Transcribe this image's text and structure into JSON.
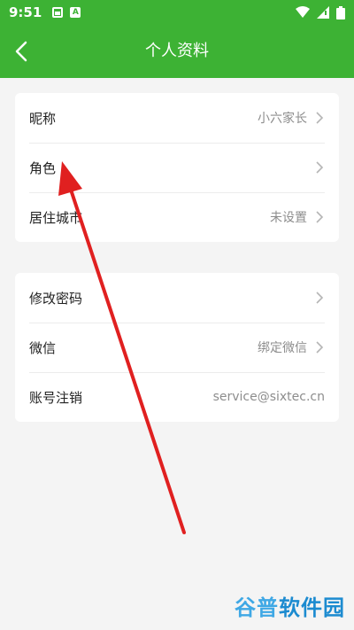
{
  "status_bar": {
    "time": "9:51"
  },
  "header": {
    "title": "个人资料"
  },
  "card1": {
    "items": [
      {
        "label": "昵称",
        "value": "小六家长"
      },
      {
        "label": "角色",
        "value": ""
      },
      {
        "label": "居住城市",
        "value": "未设置"
      }
    ]
  },
  "card2": {
    "items": [
      {
        "label": "修改密码",
        "value": ""
      },
      {
        "label": "微信",
        "value": "绑定微信"
      },
      {
        "label": "账号注销",
        "value": "service@sixtec.cn"
      }
    ]
  },
  "watermark": {
    "part1": "谷普",
    "part2": "软件园"
  },
  "colors": {
    "brand_green": "#3db234",
    "annotation_red": "#e02020"
  }
}
